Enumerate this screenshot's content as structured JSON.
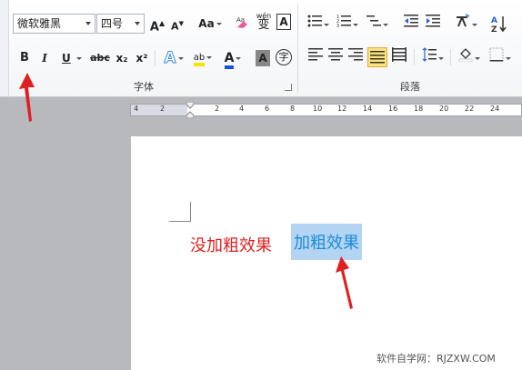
{
  "ribbon": {
    "font_group": {
      "label": "字体",
      "font_name": "微软雅黑",
      "font_size": "四号",
      "grow_label": "A",
      "shrink_label": "A",
      "case_label": "Aa",
      "pinyin_label": "wén",
      "pinyin_char": "变",
      "border_char_label": "A",
      "bold_label": "B",
      "italic_label": "I",
      "underline_label": "U",
      "strike_label": "abc",
      "subscript_label": "x₂",
      "superscript_label": "x²",
      "effects_label": "A",
      "highlight_label": "ab",
      "font_color_label": "A",
      "shading_label": "A",
      "enclose_label": "字"
    },
    "paragraph_group": {
      "label": "段落",
      "sort_label": "A↓Z"
    }
  },
  "ruler": {
    "ticks": [
      "4",
      "2",
      "",
      "2",
      "4",
      "6",
      "8",
      "10",
      "12",
      "14",
      "16",
      "18",
      "20",
      "22",
      "24"
    ]
  },
  "document": {
    "text_not_bold": "没加粗效果",
    "text_bold": "加粗效果"
  },
  "watermark": "软件自学网：RJZXW.COM",
  "colors": {
    "red_text": "#e02020",
    "blue_text": "#1a8cd8",
    "selection": "#b3d4f2",
    "arrow": "#e02020",
    "active_button": "#fde27d"
  }
}
